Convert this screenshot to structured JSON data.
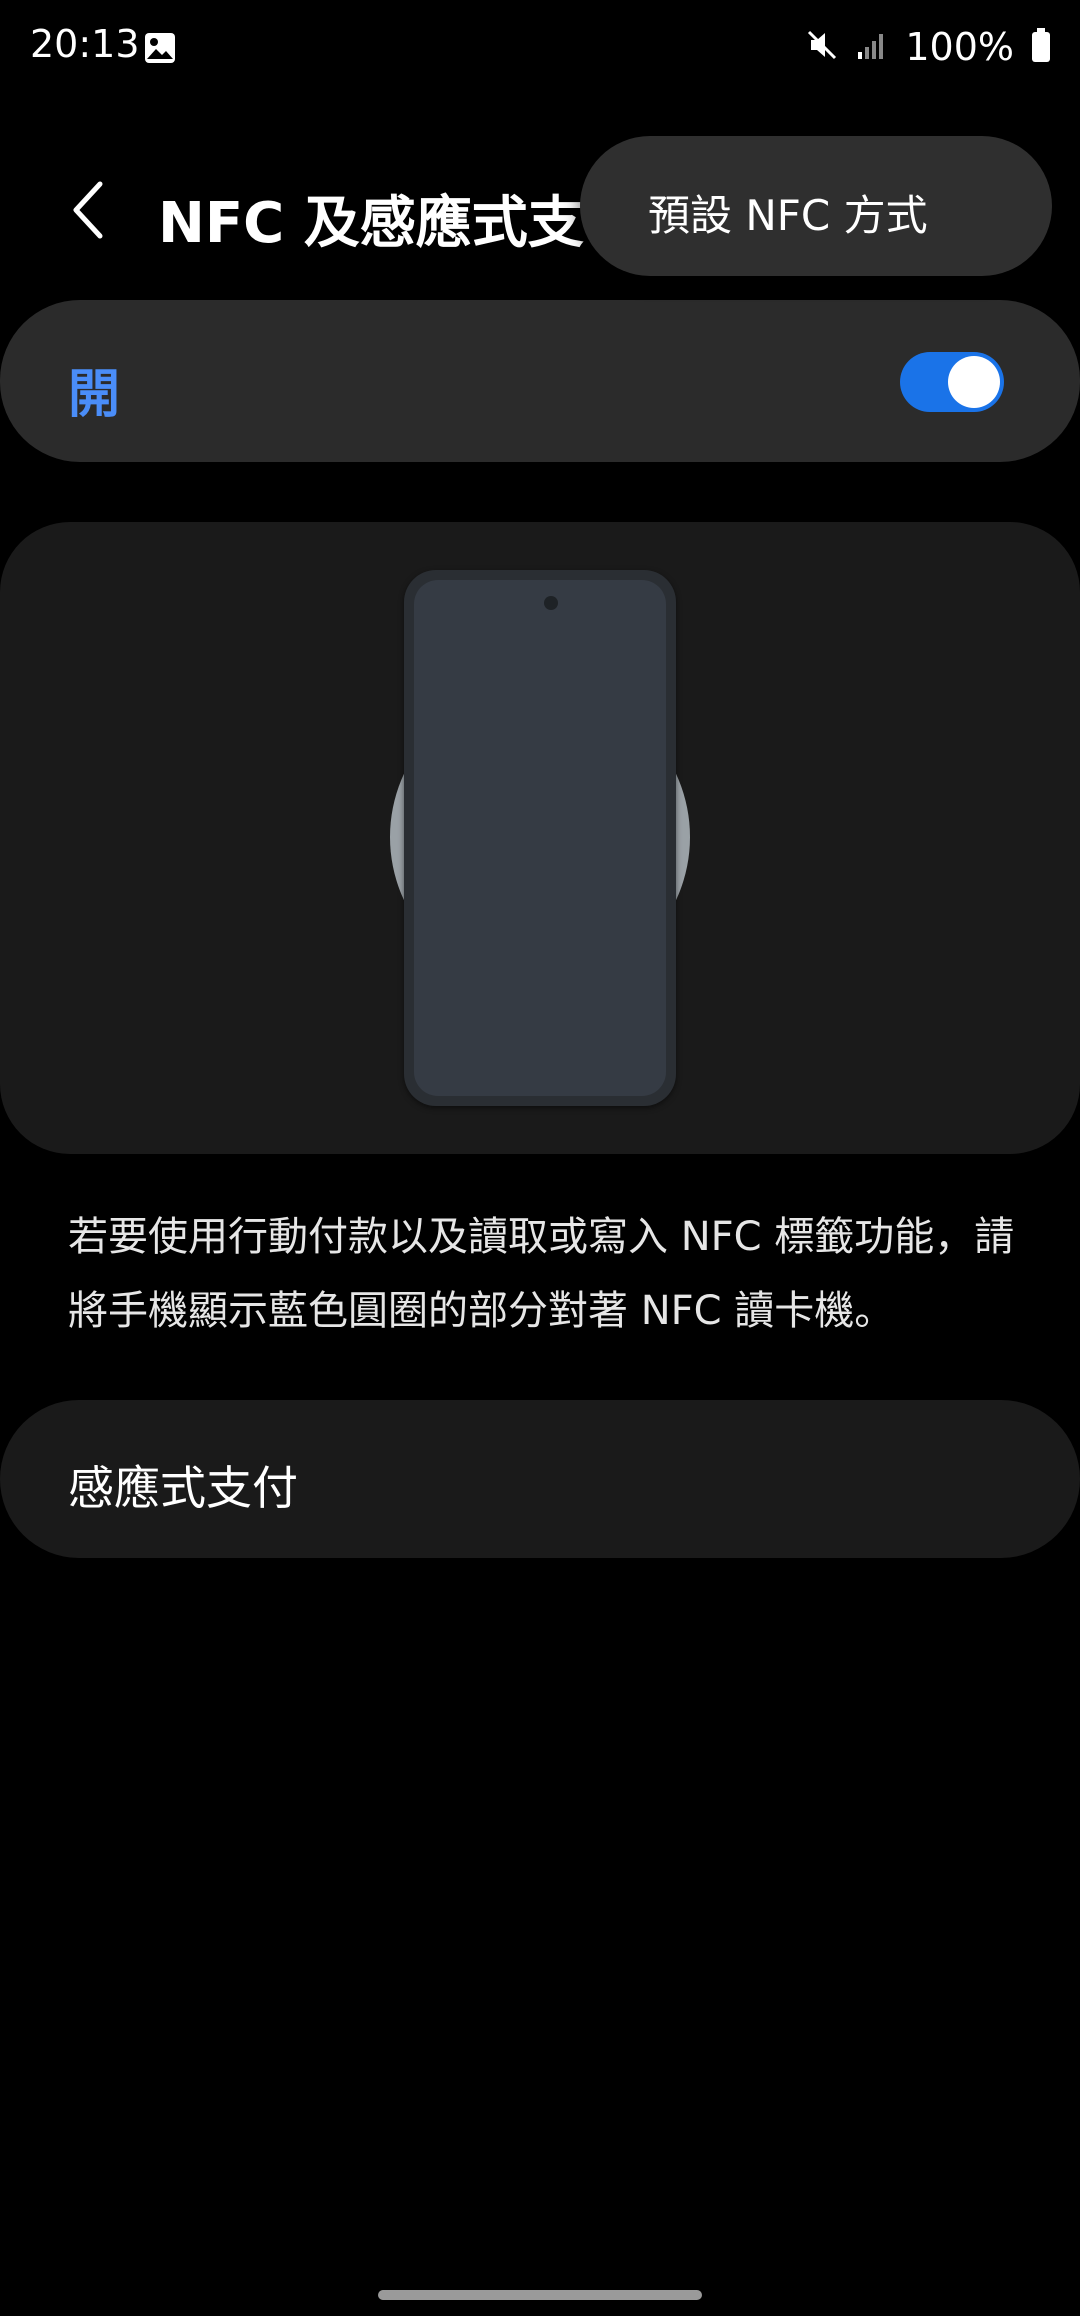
{
  "status_bar": {
    "time": "20:13",
    "battery": "100%",
    "icons": [
      "gallery-icon",
      "mute-icon",
      "signal-icon",
      "battery-icon"
    ]
  },
  "header": {
    "back_icon": "chevron-left-icon",
    "title": "NFC 及感應式支付"
  },
  "popup_menu": {
    "items": [
      {
        "label": "預設 NFC 方式"
      }
    ]
  },
  "master_switch": {
    "label": "開",
    "state": "on",
    "accent_color": "#4a8df8"
  },
  "illustration": {
    "description_icon": "phone-nfc-illustration"
  },
  "description": "若要使用行動付款以及讀取或寫入 NFC 標籤功能，請將手機顯示藍色圓圈的部分對著 NFC 讀卡機。",
  "settings": {
    "items": [
      {
        "label": "感應式支付"
      }
    ]
  }
}
